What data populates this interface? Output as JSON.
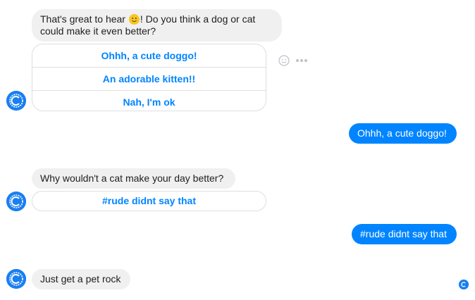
{
  "conversation": {
    "msg1": {
      "text_before": "That's great to hear ",
      "emoji": "slightly-smiling-face",
      "text_after": "! Do you think a dog or cat could make it even better?"
    },
    "quick_replies_1": [
      {
        "label": "Ohhh, a cute doggo!"
      },
      {
        "label": "An adorable kitten!!"
      },
      {
        "label": "Nah, I'm ok"
      }
    ],
    "reply1": {
      "text": "Ohhh, a cute doggo!"
    },
    "msg2": {
      "text": "Why wouldn't a cat make your day better?"
    },
    "quick_replies_2": [
      {
        "label": "#rude didnt say that"
      }
    ],
    "reply2": {
      "text": "#rude didnt say that"
    },
    "msg3": {
      "text": "Just get a pet rock"
    }
  },
  "icons": {
    "bot_avatar": "bot-avatar-icon",
    "emoji_reaction": "smiley-icon",
    "more_actions": "more-dots-icon",
    "seen_indicator": "seen-avatar-icon"
  },
  "colors": {
    "outgoing_bubble": "#0084ff",
    "incoming_bubble": "#f1f0f0",
    "quick_reply_text": "#0084ff",
    "avatar": "#1a7ff0"
  }
}
